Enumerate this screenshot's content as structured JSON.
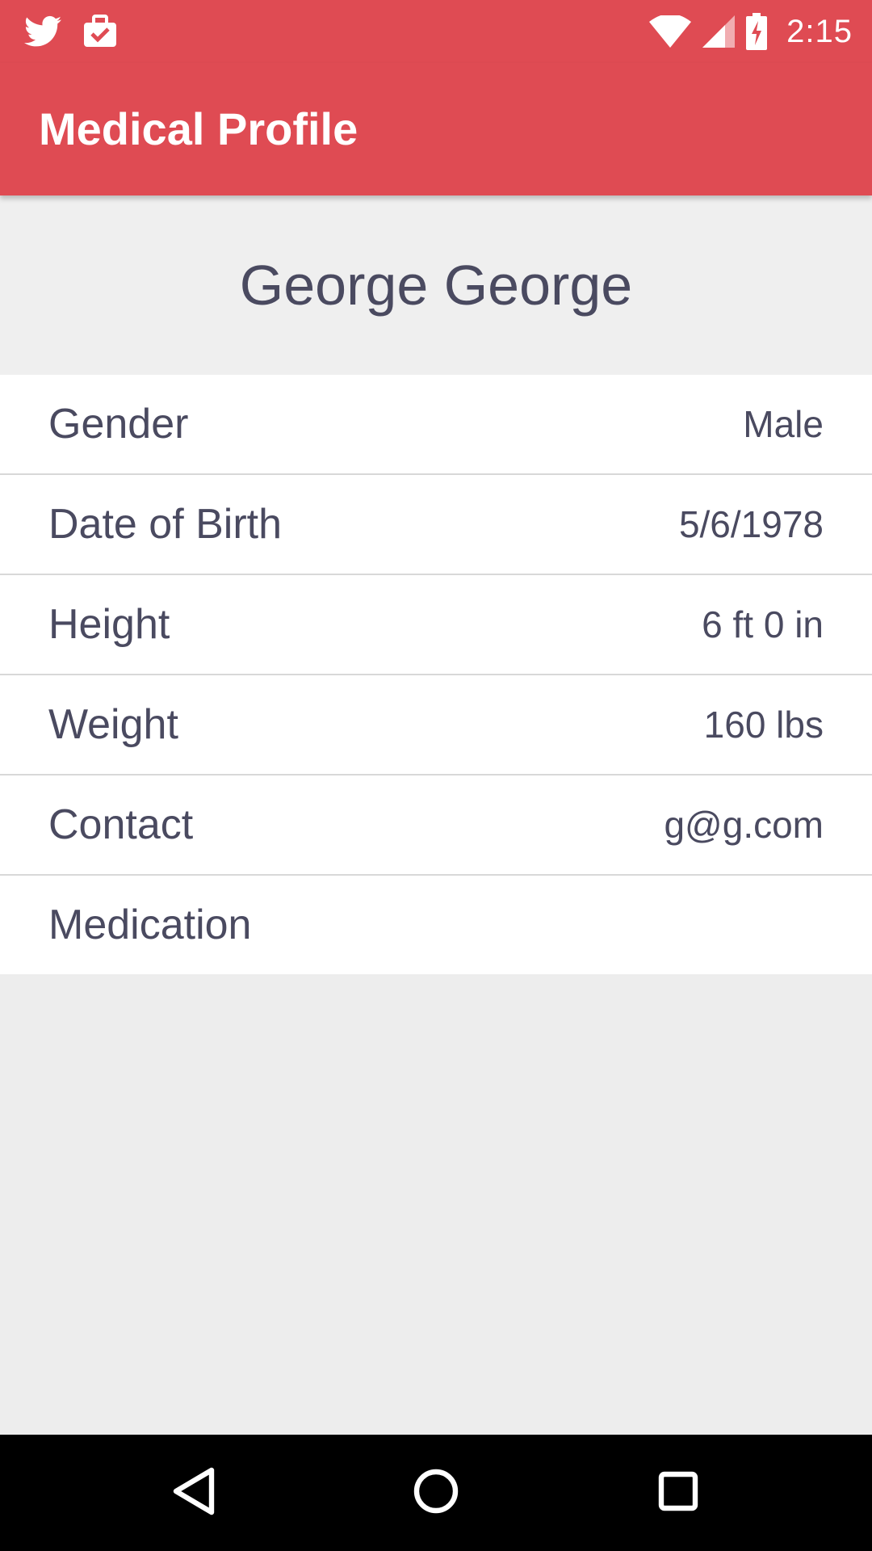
{
  "status_bar": {
    "time": "2:15",
    "left_icons": [
      "twitter-icon",
      "briefcase-check-icon"
    ],
    "right_icons": [
      "wifi-icon",
      "signal-icon",
      "battery-charging-icon"
    ]
  },
  "app_bar": {
    "title": "Medical Profile"
  },
  "profile": {
    "name": "George George"
  },
  "fields": [
    {
      "label": "Gender",
      "value": "Male"
    },
    {
      "label": "Date of Birth",
      "value": "5/6/1978"
    },
    {
      "label": "Height",
      "value": "6 ft 0 in"
    },
    {
      "label": "Weight",
      "value": "160 lbs"
    },
    {
      "label": "Contact",
      "value": "g@g.com"
    },
    {
      "label": "Medication",
      "value": ""
    }
  ],
  "nav_bar": {
    "buttons": [
      "back-icon",
      "home-icon",
      "recents-icon"
    ]
  },
  "colors": {
    "accent": "#df4b53",
    "text": "#4a4a60",
    "background": "#ededed"
  }
}
